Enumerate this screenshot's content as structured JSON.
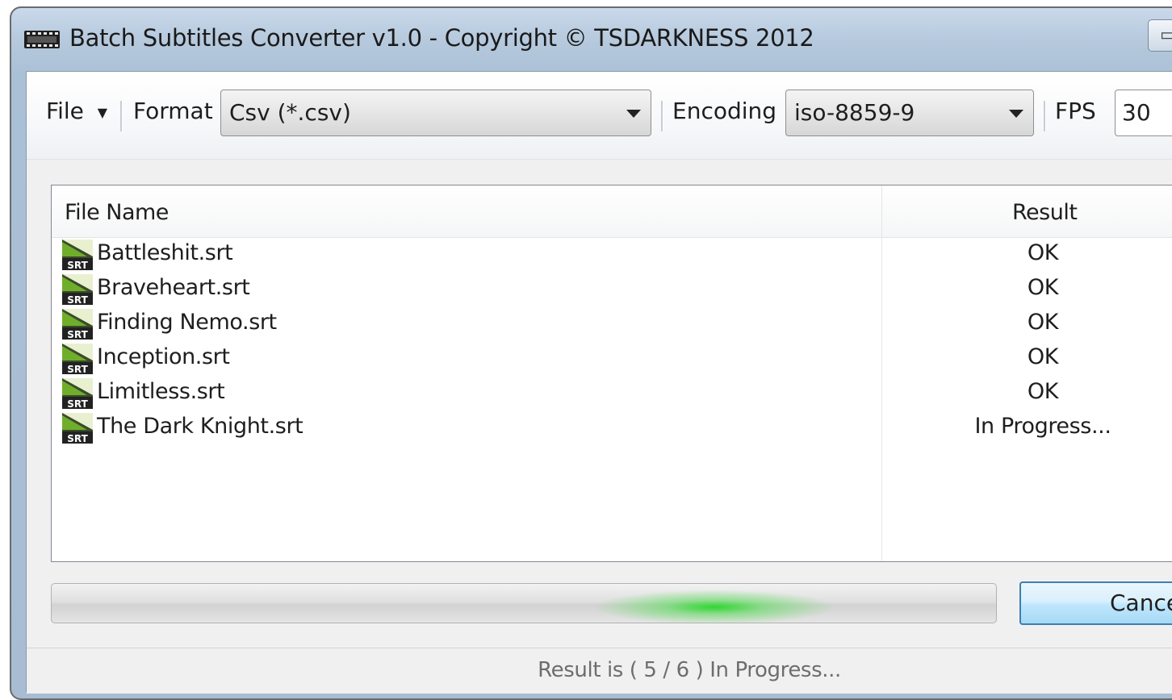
{
  "window": {
    "title": "Batch Subtitles Converter v1.0 - Copyright © TSDARKNESS 2012",
    "icon": "film-strip-icon"
  },
  "toolbar": {
    "file_menu": "File",
    "format_label": "Format",
    "format_value": "Csv (*.csv)",
    "encoding_label": "Encoding",
    "encoding_value": "iso-8859-9",
    "fps_label": "FPS",
    "fps_value": "30"
  },
  "list": {
    "columns": [
      "File Name",
      "Result"
    ],
    "rows": [
      {
        "name": "Battleshit.srt",
        "result": "OK",
        "icon": "srt-file-icon"
      },
      {
        "name": "Braveheart.srt",
        "result": "OK",
        "icon": "srt-file-icon"
      },
      {
        "name": "Finding Nemo.srt",
        "result": "OK",
        "icon": "srt-file-icon"
      },
      {
        "name": "Inception.srt",
        "result": "OK",
        "icon": "srt-file-icon"
      },
      {
        "name": "Limitless.srt",
        "result": "OK",
        "icon": "srt-file-icon"
      },
      {
        "name": "The Dark Knight.srt",
        "result": "In Progress...",
        "icon": "srt-file-icon"
      }
    ]
  },
  "progress": {
    "value_fraction": 0.83,
    "accent_color": "#2bd62b"
  },
  "actions": {
    "cancel_label": "Cancel"
  },
  "status": {
    "text": "Result is ( 5 / 6 ) In Progress..."
  }
}
